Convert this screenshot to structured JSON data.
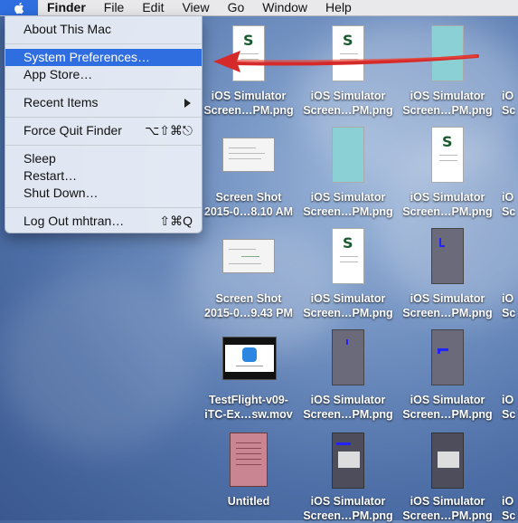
{
  "menubar": {
    "apple_icon": "apple-logo",
    "items": [
      {
        "label": "Finder",
        "bold": true
      },
      {
        "label": "File"
      },
      {
        "label": "Edit"
      },
      {
        "label": "View"
      },
      {
        "label": "Go"
      },
      {
        "label": "Window"
      },
      {
        "label": "Help"
      }
    ]
  },
  "apple_menu": {
    "items": [
      {
        "label": "About This Mac"
      },
      {
        "label": "System Preferences…",
        "highlighted": true
      },
      {
        "label": "App Store…"
      },
      {
        "label": "Recent Items",
        "submenu": true
      },
      {
        "label": "Force Quit Finder",
        "shortcut": "⌥⇧⌘⎋"
      },
      {
        "label": "Sleep"
      },
      {
        "label": "Restart…"
      },
      {
        "label": "Shut Down…"
      },
      {
        "label": "Log Out mhtran…",
        "shortcut": "⇧⌘Q"
      }
    ]
  },
  "annotation": {
    "color": "#d62a2a",
    "type": "red-arrow"
  },
  "desktop_icons": [
    {
      "line1": "iOS Simulator",
      "line2": "Screen…PM.png",
      "kind": "phone-s"
    },
    {
      "line1": "iOS Simulator",
      "line2": "Screen…PM.png",
      "kind": "phone-s"
    },
    {
      "line1": "iOS Simulator",
      "line2": "Screen…PM.png",
      "kind": "phone-teal"
    },
    {
      "line1": "Screen Shot",
      "line2": "2015-0…8.10 AM",
      "kind": "shot"
    },
    {
      "line1": "iOS Simulator",
      "line2": "Screen…PM.png",
      "kind": "phone-teal"
    },
    {
      "line1": "iOS Simulator",
      "line2": "Screen…PM.png",
      "kind": "phone-s"
    },
    {
      "line1": "Screen Shot",
      "line2": "2015-0…9.43 PM",
      "kind": "shot"
    },
    {
      "line1": "iOS Simulator",
      "line2": "Screen…PM.png",
      "kind": "phone-s"
    },
    {
      "line1": "iOS Simulator",
      "line2": "Screen…PM.png",
      "kind": "phone-dark"
    },
    {
      "line1": "TestFlight-v09-",
      "line2": "iTC-Ex…sw.mov",
      "kind": "testflight"
    },
    {
      "line1": "iOS Simulator",
      "line2": "Screen…PM.png",
      "kind": "phone-dark"
    },
    {
      "line1": "iOS Simulator",
      "line2": "Screen…PM.png",
      "kind": "phone-dark"
    },
    {
      "line1": "Untitled",
      "line2": "",
      "kind": "pinkdoc"
    },
    {
      "line1": "iOS Simulator",
      "line2": "Screen…PM.png",
      "kind": "phone-darker"
    },
    {
      "line1": "iOS Simulator",
      "line2": "Screen…PM.png",
      "kind": "phone-darker"
    }
  ],
  "partial_column_labels": [
    "iO",
    "Sc",
    "iO",
    "Sc",
    "iO",
    "Sc",
    "iO",
    "Sc",
    "iO",
    "Sc"
  ]
}
